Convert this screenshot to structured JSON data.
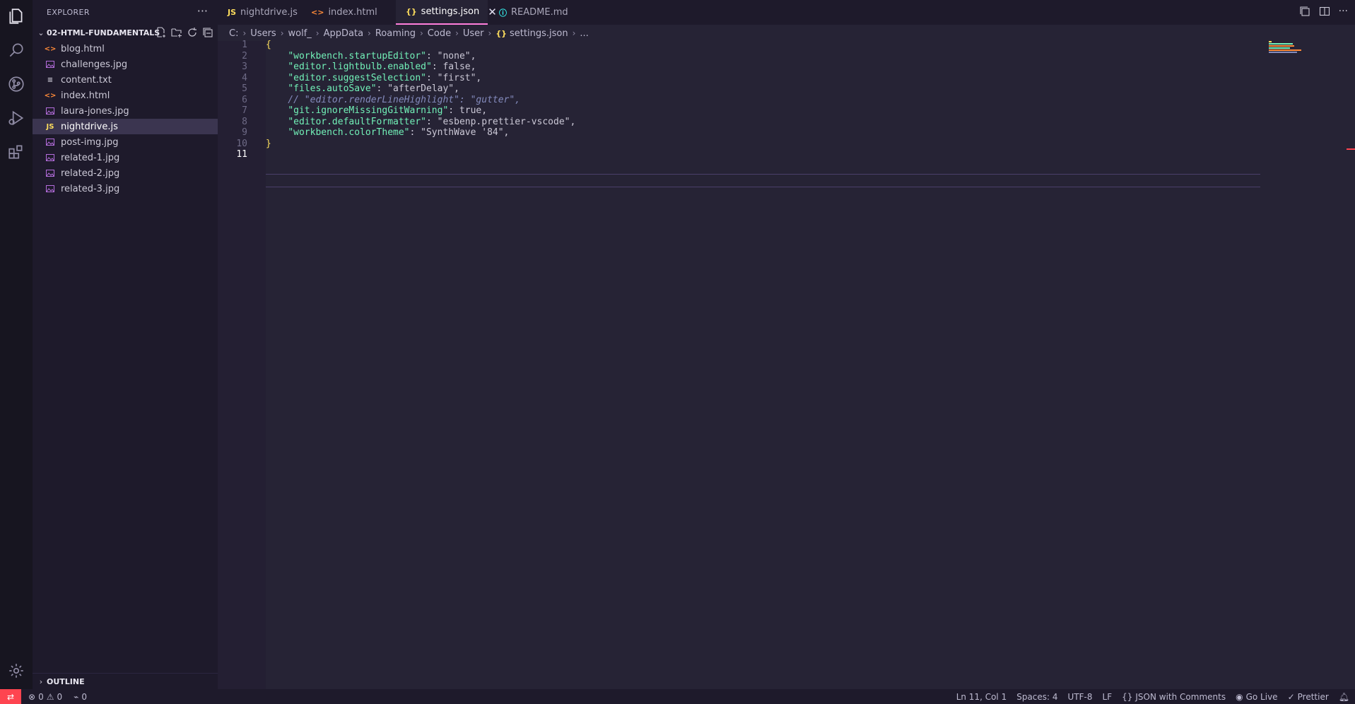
{
  "sidebar": {
    "title": "EXPLORER",
    "more": "···",
    "folder": "02-HTML-FUNDAMENTALS",
    "files": [
      {
        "name": "blog.html",
        "icon": "html-icon"
      },
      {
        "name": "challenges.jpg",
        "icon": "image-icon"
      },
      {
        "name": "content.txt",
        "icon": "text-icon"
      },
      {
        "name": "index.html",
        "icon": "html-icon"
      },
      {
        "name": "laura-jones.jpg",
        "icon": "image-icon"
      },
      {
        "name": "nightdrive.js",
        "icon": "js-icon",
        "selected": true
      },
      {
        "name": "post-img.jpg",
        "icon": "image-icon"
      },
      {
        "name": "related-1.jpg",
        "icon": "image-icon"
      },
      {
        "name": "related-2.jpg",
        "icon": "image-icon"
      },
      {
        "name": "related-3.jpg",
        "icon": "image-icon"
      }
    ],
    "outline": "OUTLINE"
  },
  "tabs": [
    {
      "label": "nightdrive.js",
      "icon": "JS"
    },
    {
      "label": "index.html",
      "icon": "<>"
    },
    {
      "label": "settings.json",
      "icon": "{}",
      "active": true
    },
    {
      "label": "README.md",
      "icon": "ⓘ"
    }
  ],
  "breadcrumb": [
    "C:",
    "Users",
    "wolf_",
    "AppData",
    "Roaming",
    "Code",
    "User",
    "settings.json",
    "..."
  ],
  "editor": {
    "lines": [
      {
        "n": "1",
        "text": "{"
      },
      {
        "n": "2",
        "text": "    \"workbench.startupEditor\": \"none\","
      },
      {
        "n": "3",
        "text": "    \"editor.lightbulb.enabled\": false,"
      },
      {
        "n": "4",
        "text": "    \"editor.suggestSelection\": \"first\","
      },
      {
        "n": "5",
        "text": "    \"files.autoSave\": \"afterDelay\","
      },
      {
        "n": "6",
        "text": "    // \"editor.renderLineHighlight\": \"gutter\","
      },
      {
        "n": "7",
        "text": "    \"git.ignoreMissingGitWarning\": true,"
      },
      {
        "n": "8",
        "text": "    \"editor.defaultFormatter\": \"esbenp.prettier-vscode\","
      },
      {
        "n": "9",
        "text": "    \"workbench.colorTheme\": \"SynthWave '84\","
      },
      {
        "n": "10",
        "text": "}"
      },
      {
        "n": "11",
        "text": ""
      }
    ],
    "current_line": "11"
  },
  "statusbar": {
    "errors": "0",
    "warnings": "0",
    "ports": "0",
    "position": "Ln 11, Col 1",
    "spaces": "Spaces: 4",
    "encoding": "UTF-8",
    "eol": "LF",
    "language": "JSON with Comments",
    "golive": "Go Live",
    "prettier": "Prettier"
  },
  "colors": {
    "accent": "#ff7edb",
    "key": "#72f1b8",
    "string": "#ff8b39",
    "keyword": "#fe4450",
    "brace": "#fede5d",
    "remote": "#fe4450"
  }
}
